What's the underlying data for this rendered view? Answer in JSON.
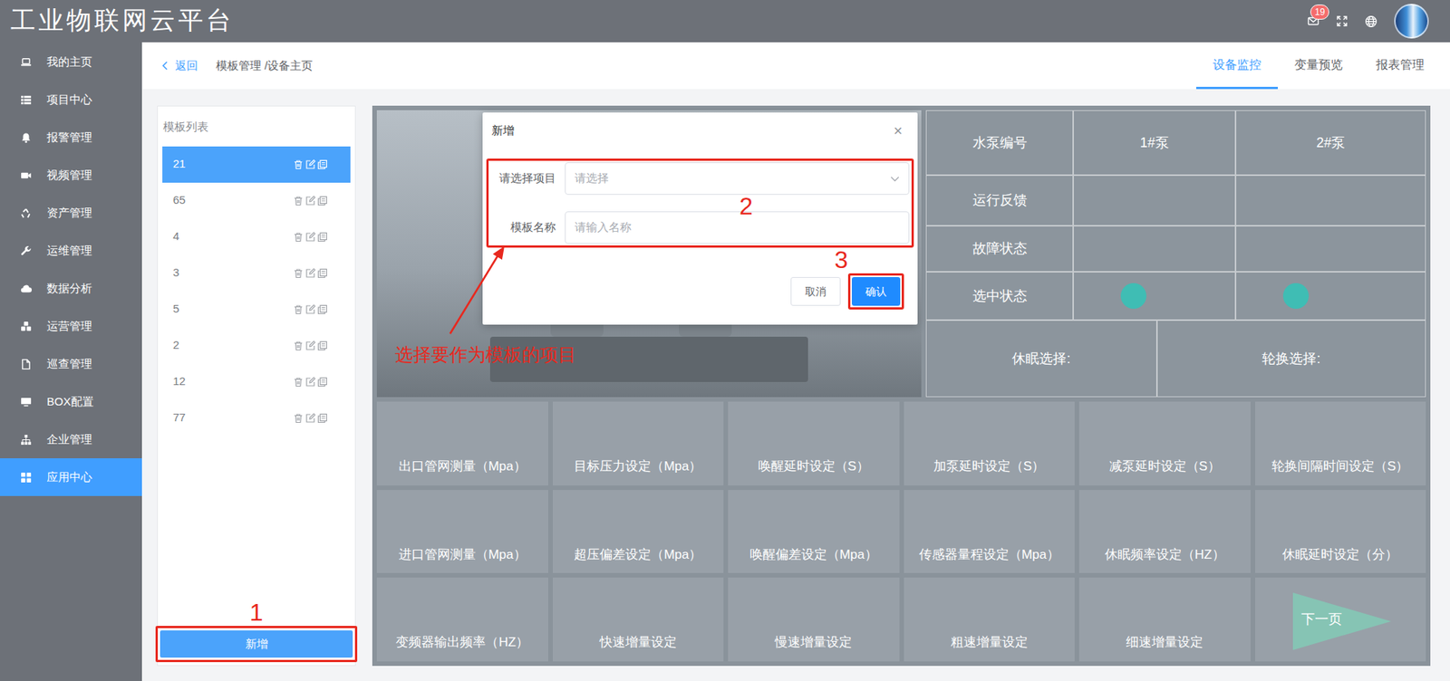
{
  "app": {
    "title": "工业物联网云平台",
    "mail_badge": "19"
  },
  "sidebar": {
    "items": [
      {
        "label": "我的主页",
        "selected": false
      },
      {
        "label": "项目中心",
        "selected": false
      },
      {
        "label": "报警管理",
        "selected": false
      },
      {
        "label": "视频管理",
        "selected": false
      },
      {
        "label": "资产管理",
        "selected": false
      },
      {
        "label": "运维管理",
        "selected": false
      },
      {
        "label": "数据分析",
        "selected": false
      },
      {
        "label": "运营管理",
        "selected": false
      },
      {
        "label": "巡查管理",
        "selected": false
      },
      {
        "label": "BOX配置",
        "selected": false
      },
      {
        "label": "企业管理",
        "selected": false
      },
      {
        "label": "应用中心",
        "selected": true
      }
    ]
  },
  "breadcrumb": {
    "back": "返回",
    "path": "模板管理 /设备主页"
  },
  "tabs": [
    {
      "label": "设备监控",
      "selected": true
    },
    {
      "label": "变量预览",
      "selected": false
    },
    {
      "label": "报表管理",
      "selected": false
    }
  ],
  "template_list": {
    "title": "模板列表",
    "items": [
      {
        "label": "21",
        "selected": true
      },
      {
        "label": "65",
        "selected": false
      },
      {
        "label": "4",
        "selected": false
      },
      {
        "label": "3",
        "selected": false
      },
      {
        "label": "5",
        "selected": false
      },
      {
        "label": "2",
        "selected": false
      },
      {
        "label": "12",
        "selected": false
      },
      {
        "label": "77",
        "selected": false
      }
    ],
    "add_button": "新增"
  },
  "pump_table": {
    "header": [
      "水泵编号",
      "1#泵",
      "2#泵"
    ],
    "rows": [
      {
        "label": "运行反馈",
        "kind": "blank",
        "on": [
          false,
          false
        ]
      },
      {
        "label": "故障状态",
        "kind": "blank",
        "on": [
          false,
          false
        ]
      },
      {
        "label": "选中状态",
        "kind": "dots",
        "on": [
          true,
          true
        ]
      }
    ],
    "footer": [
      "休眠选择:",
      "轮换选择:"
    ]
  },
  "tiles": {
    "items": [
      "出口管网测量（Mpa）",
      "目标压力设定（Mpa）",
      "唤醒延时设定（S）",
      "加泵延时设定（S）",
      "减泵延时设定（S）",
      "轮换间隔时间设定（S）",
      "进口管网测量（Mpa）",
      "超压偏差设定（Mpa）",
      "唤醒偏差设定（Mpa）",
      "传感器量程设定（Mpa）",
      "休眠频率设定（HZ）",
      "休眠延时设定（分）",
      "变频器输出频率（HZ）",
      "快速增量设定",
      "慢速增量设定",
      "粗速增量设定",
      "细速增量设定"
    ],
    "next_page": "下一页"
  },
  "dialog": {
    "title": "新增",
    "close": "×",
    "fields": [
      {
        "label": "请选择项目",
        "kind": "select",
        "placeholder": "请选择"
      },
      {
        "label": "模板名称",
        "kind": "input",
        "placeholder": "请输入名称"
      }
    ],
    "buttons": [
      {
        "label": "取消",
        "primary": false
      },
      {
        "label": "确认",
        "primary": true
      }
    ]
  },
  "annotations": {
    "steps": [
      "1",
      "2",
      "3"
    ],
    "note": "选择要作为模板的项目"
  }
}
